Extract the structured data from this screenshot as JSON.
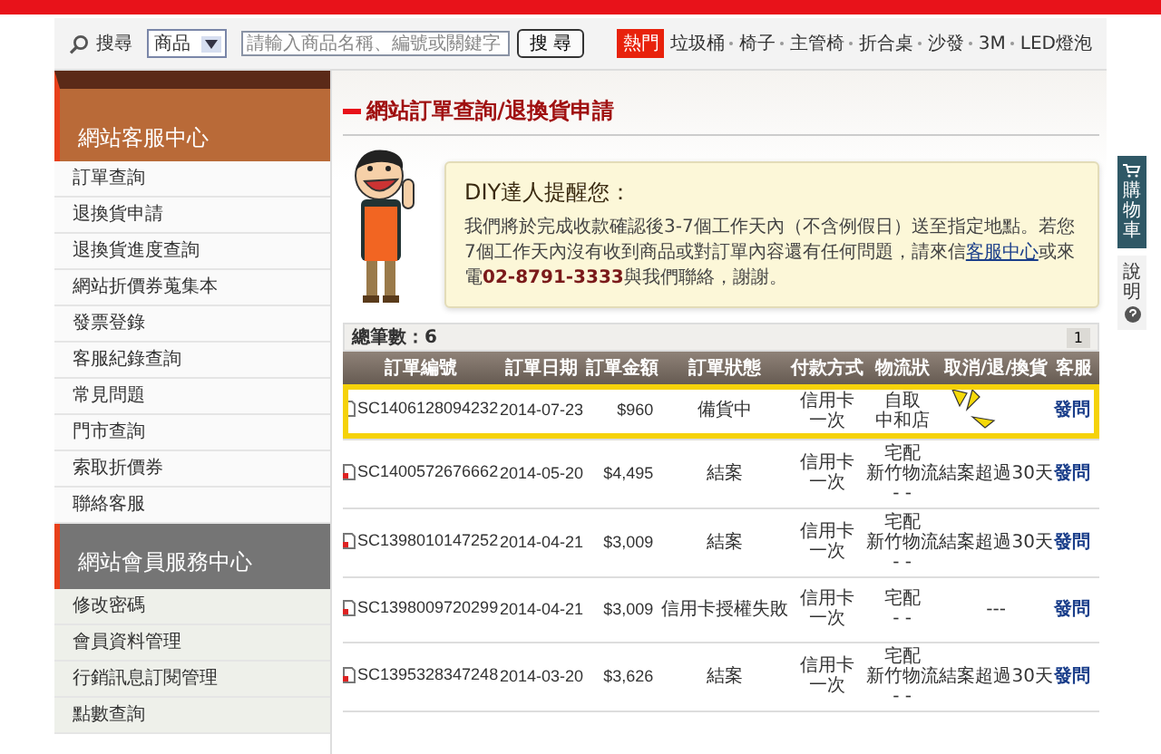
{
  "search_bar": {
    "label": "搜尋",
    "category": "商品",
    "placeholder": "請輸入商品名稱、編號或關鍵字",
    "button": "搜 尋",
    "hot_badge": "熱門",
    "hot_links": [
      "垃圾桶",
      "椅子",
      "主管椅",
      "折合桌",
      "沙發",
      "3M",
      "LED燈泡"
    ]
  },
  "sidebar": {
    "sections": [
      {
        "title": "網站客服中心",
        "kind": "primary",
        "items": [
          "訂單查詢",
          "退換貨申請",
          "退換貨進度查詢",
          "網站折價券蒐集本",
          "發票登錄",
          "客服紀錄查詢",
          "常見問題",
          "門市查詢",
          "索取折價券",
          "聯絡客服"
        ]
      },
      {
        "title": "網站會員服務中心",
        "kind": "secondary",
        "items": [
          "修改密碼",
          "會員資料管理",
          "行銷訊息訂閱管理",
          "點數查詢"
        ]
      }
    ]
  },
  "page_title": "網站訂單查詢/退換貨申請",
  "notice": {
    "title": "DIY達人提醒您：",
    "text_before": "我們將於完成收款確認後3-7個工作天內（不含例假日）送至指定地點。若您7個工作天內沒有收到商品或對訂單內容還有任何問題，請來信",
    "link": "客服中心",
    "text_after": "或來電**02-8791-3333**與我們聯絡，謝謝。"
  },
  "orders": {
    "total": "總筆數：6",
    "page": "1",
    "columns": [
      "訂單編號",
      "訂單日期",
      "訂單金額",
      "訂單狀態",
      "付款方式",
      "物流狀",
      "取消/退/換貨",
      "客服"
    ],
    "rows": [
      {
        "id": "SC1406128094232",
        "date": "2014-07-23",
        "amount": "$960",
        "status": "備貨中",
        "payment": [
          "信用卡",
          "一次"
        ],
        "logistics": [
          "自取",
          "中和店"
        ],
        "cancel": "",
        "service": "發問",
        "highlighted": true
      },
      {
        "id": "SC1400572676662",
        "date": "2014-05-20",
        "amount": "$4,495",
        "status": "結案",
        "payment": [
          "信用卡",
          "一次"
        ],
        "logistics": [
          "宅配",
          "新竹物流",
          "- -"
        ],
        "cancel": "結案超過30天",
        "service": "發問",
        "highlighted": false
      },
      {
        "id": "SC1398010147252",
        "date": "2014-04-21",
        "amount": "$3,009",
        "status": "結案",
        "payment": [
          "信用卡",
          "一次"
        ],
        "logistics": [
          "宅配",
          "新竹物流",
          "- -"
        ],
        "cancel": "結案超過30天",
        "service": "發問",
        "highlighted": false
      },
      {
        "id": "SC1398009720299",
        "date": "2014-04-21",
        "amount": "$3,009",
        "status": "信用卡授權失敗",
        "payment": [
          "信用卡",
          "一次"
        ],
        "logistics": [
          "宅配",
          "- -"
        ],
        "cancel": "---",
        "service": "發問",
        "highlighted": false
      },
      {
        "id": "SC1395328347248",
        "date": "2014-03-20",
        "amount": "$3,626",
        "status": "結案",
        "payment": [
          "信用卡",
          "一次"
        ],
        "logistics": [
          "宅配",
          "新竹物流",
          "- -"
        ],
        "cancel": "結案超過30天",
        "service": "發問",
        "highlighted": false
      }
    ]
  },
  "side_tabs": [
    {
      "label": "購物車",
      "kind": "cart"
    },
    {
      "label": "說明",
      "kind": "help"
    }
  ]
}
